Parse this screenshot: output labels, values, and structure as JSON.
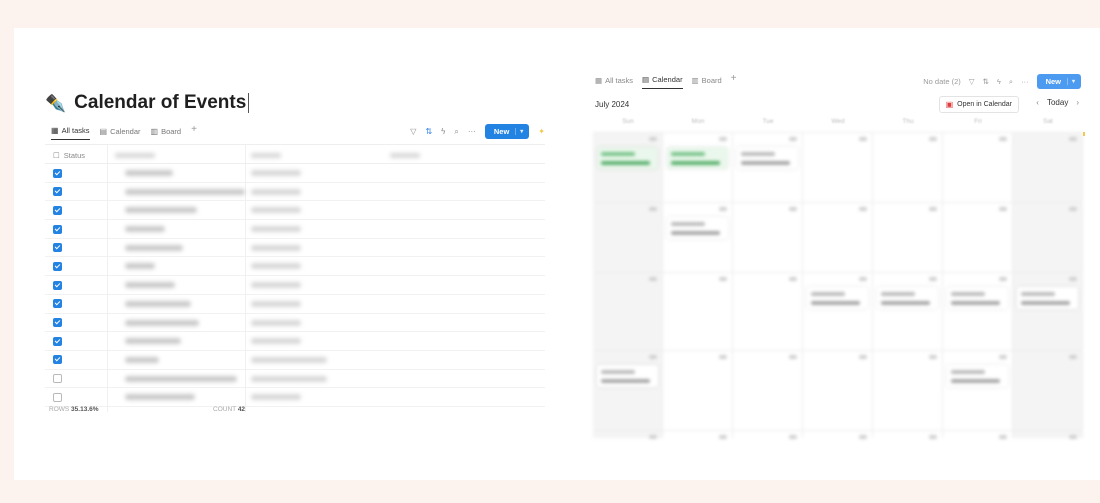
{
  "page": {
    "title": "Calendar of Events",
    "title_icon": "✒️"
  },
  "left_view": {
    "tabs": [
      {
        "label": "All tasks",
        "icon": "table-icon",
        "active": true
      },
      {
        "label": "Calendar",
        "icon": "calendar-icon",
        "active": false
      },
      {
        "label": "Board",
        "icon": "board-icon",
        "active": false
      }
    ],
    "toolbar": {
      "filter_icon": "filter-icon",
      "sort_icon": "sort-icon",
      "lightning_icon": "lightning-icon",
      "search_icon": "search-icon",
      "more_icon": "more-icon",
      "new_label": "New"
    },
    "table": {
      "status_header": "Status",
      "rows": [
        {
          "done": true
        },
        {
          "done": true
        },
        {
          "done": true
        },
        {
          "done": true
        },
        {
          "done": true
        },
        {
          "done": true
        },
        {
          "done": true
        },
        {
          "done": true
        },
        {
          "done": true
        },
        {
          "done": true
        },
        {
          "done": true
        },
        {
          "done": false
        },
        {
          "done": false
        }
      ]
    },
    "footer": {
      "left_label": "ROWS",
      "left_value": "35.13.6%",
      "right_label": "COUNT",
      "right_value": "42"
    }
  },
  "right_view": {
    "tabs": [
      {
        "label": "All tasks",
        "icon": "table-icon",
        "active": false
      },
      {
        "label": "Calendar",
        "icon": "calendar-icon",
        "active": true
      },
      {
        "label": "Board",
        "icon": "board-icon",
        "active": false
      }
    ],
    "toolbar": {
      "no_date_label": "No date (2)",
      "new_label": "New"
    },
    "month_label": "July 2024",
    "open_in_calendar_label": "Open in Calendar",
    "today_label": "Today",
    "weekdays": [
      "Sun",
      "Mon",
      "Tue",
      "Wed",
      "Thu",
      "Fri",
      "Sat"
    ]
  },
  "colors": {
    "page_background": "#fdf3ee",
    "accent_blue": "#2383e2",
    "event_green": "#eaf7ec",
    "calendar_red": "#e03e3e"
  }
}
